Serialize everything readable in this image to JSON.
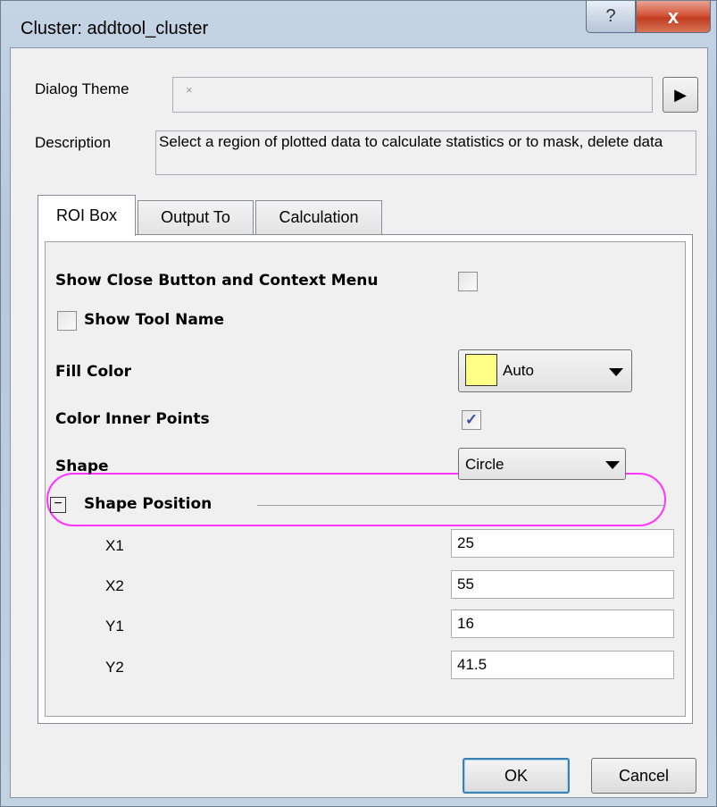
{
  "window": {
    "title": "Cluster: addtool_cluster",
    "help_glyph": "?",
    "close_glyph": "x"
  },
  "dialog_theme": {
    "label": "Dialog Theme",
    "value": "×",
    "arrow_glyph": "▶"
  },
  "description": {
    "label": "Description",
    "text": "Select a region of plotted data to calculate statistics or to mask, delete data"
  },
  "tabs": [
    {
      "label": "ROI Box",
      "active": true
    },
    {
      "label": "Output To",
      "active": false
    },
    {
      "label": "Calculation",
      "active": false
    }
  ],
  "roi_box": {
    "show_close_button_label": "Show Close Button and Context Menu",
    "show_close_button_checked": false,
    "show_tool_name_label": "Show Tool Name",
    "show_tool_name_checked": false,
    "fill_color_label": "Fill Color",
    "fill_color_value": "Auto",
    "fill_color_swatch": "#ffff88",
    "color_inner_points_label": "Color Inner Points",
    "color_inner_points_checked": true,
    "check_glyph": "✓",
    "shape_label": "Shape",
    "shape_value": "Circle",
    "shape_position_label": "Shape Position",
    "collapse_glyph": "−",
    "highlight_color": "#ff33ff",
    "positions": [
      {
        "label": "X1",
        "value": "25"
      },
      {
        "label": "X2",
        "value": "55"
      },
      {
        "label": "Y1",
        "value": "16"
      },
      {
        "label": "Y2",
        "value": "41.5"
      }
    ]
  },
  "buttons": {
    "ok": "OK",
    "cancel": "Cancel"
  }
}
